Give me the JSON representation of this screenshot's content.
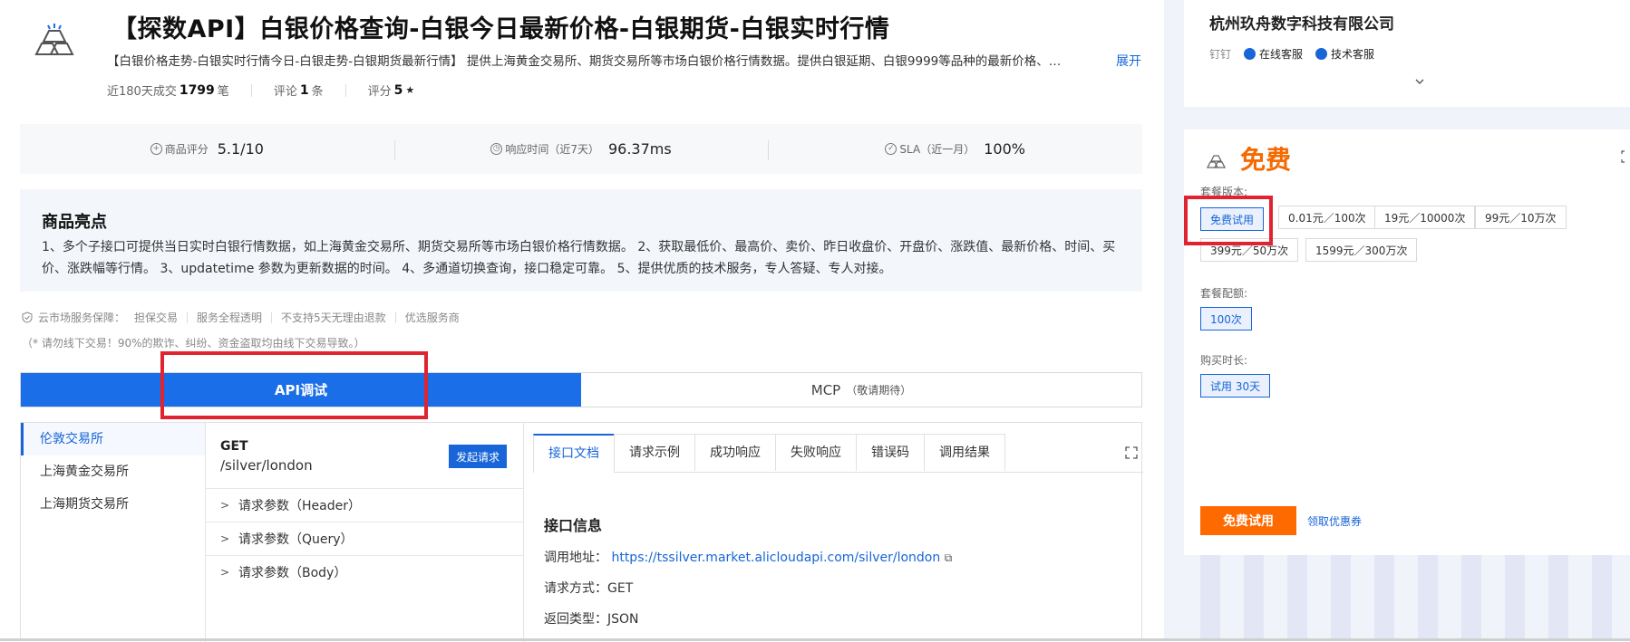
{
  "product": {
    "title": "【探数API】白银价格查询-白银今日最新价格-白银期货-白银实时行情",
    "description": "【白银价格走势-白银实时行情今日-白银走势-白银期货最新行情】 提供上海黄金交易所、期货交易所等市场白银价格行情数据。提供白银延期、白银9999等品种的最新价格、…",
    "expand_label": "展开",
    "sales_label": "近180天成交",
    "sales_value": "1799",
    "sales_unit": "笔",
    "reviews_label": "评论",
    "reviews_value": "1",
    "reviews_unit": "条",
    "rating_label": "评分",
    "rating_value": "5",
    "rating_star": "★"
  },
  "metrics": [
    {
      "icon": "plus-circle-icon",
      "label": "商品评分",
      "value": "5.1/10"
    },
    {
      "icon": "clock-icon",
      "label": "响应时间（近7天）",
      "value": "96.37ms"
    },
    {
      "icon": "check-circle-icon",
      "label": "SLA（近一月）",
      "value": "100%"
    }
  ],
  "highlights": {
    "title": "商品亮点",
    "text": "1、多个子接口可提供当日实时白银行情数据，如上海黄金交易所、期货交易所等市场白银价格行情数据。 2、获取最低价、最高价、卖价、昨日收盘价、开盘价、涨跌值、最新价格、时间、买价、涨跌幅等行情。 3、updatetime 参数为更新数据的时间。 4、多通道切换查询，接口稳定可靠。 5、提供优质的技术服务，专人答疑、专人对接。"
  },
  "guarantee": {
    "label": "云市场服务保障：",
    "items": [
      "担保交易",
      "服务全程透明",
      "不支持5天无理由退款",
      "优选服务商"
    ],
    "warning": "（* 请勿线下交易！90%的欺诈、纠纷、资金盗取均由线下交易导致。）"
  },
  "tabs": {
    "api": "API调试",
    "mcp": "MCP",
    "mcp_note": "（敬请期待）"
  },
  "exchanges": [
    "伦敦交易所",
    "上海黄金交易所",
    "上海期货交易所"
  ],
  "request": {
    "method": "GET",
    "path": "/silver/london",
    "send_label": "发起请求",
    "params": [
      "请求参数（Header）",
      "请求参数（Query）",
      "请求参数（Body）"
    ]
  },
  "doc": {
    "tabs": [
      "接口文档",
      "请求示例",
      "成功响应",
      "失败响应",
      "错误码",
      "调用结果"
    ],
    "heading": "接口信息",
    "address_label": "调用地址：",
    "address": "https://tssilver.market.alicloudapi.com/silver/london",
    "method_label": "请求方式：",
    "method": "GET",
    "return_label": "返回类型：",
    "return_type": "JSON"
  },
  "vendor": {
    "name": "杭州玖舟数字科技有限公司",
    "dingtalk": "钉钉",
    "online_service": "在线客服",
    "tech_service": "技术客服"
  },
  "pricing": {
    "price_label": "免费",
    "version_label": "套餐版本:",
    "versions": [
      "免费试用",
      "0.01元／100次",
      "19元／10000次",
      "99元／10万次",
      "399元／50万次",
      "1599元／300万次"
    ],
    "quota_label": "套餐配额:",
    "quota": "100次",
    "duration_label": "购买时长:",
    "duration": "试用 30天",
    "buy_label": "免费试用",
    "coupon_label": "领取优惠券"
  },
  "colors": {
    "primary_blue": "#1a6ee8",
    "accent_orange": "#f56a00",
    "highlight_red": "#e0232f"
  }
}
